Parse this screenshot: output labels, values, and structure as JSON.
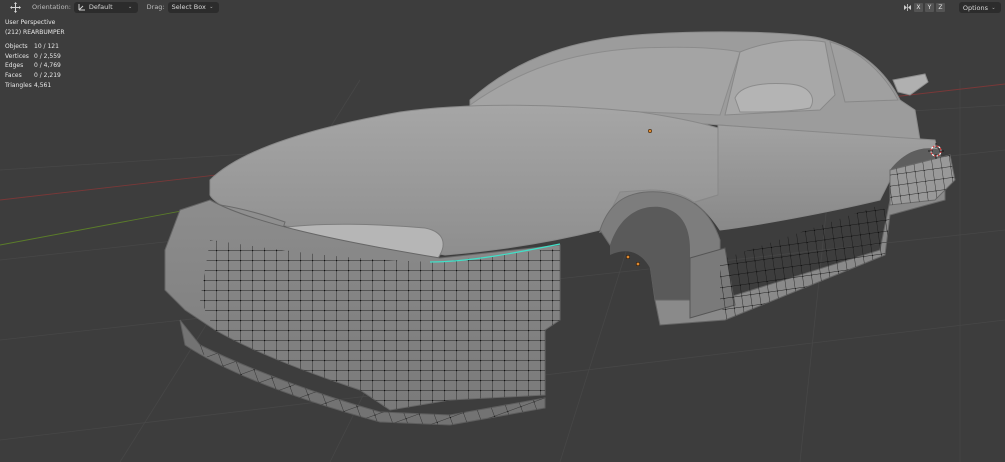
{
  "header": {
    "orientation_label": "Orientation:",
    "orientation_value": "Default",
    "drag_label": "Drag:",
    "drag_value": "Select Box",
    "axes": [
      "X",
      "Y",
      "Z"
    ],
    "options_label": "Options"
  },
  "overlay": {
    "view_name": "User Perspective",
    "object_name": "(212) REARBUMPER",
    "stats": [
      {
        "label": "Objects",
        "value": "10 / 121"
      },
      {
        "label": "Vertices",
        "value": "0 / 2,559"
      },
      {
        "label": "Edges",
        "value": "0 / 4,769"
      },
      {
        "label": "Faces",
        "value": "0 / 2,219"
      },
      {
        "label": "Triangles",
        "value": "4,561"
      }
    ]
  },
  "icons": {
    "transform": "move-gizmo-icon",
    "orientation": "transform-orientation-icon",
    "mirror": "mirror-butterfly-icon",
    "pivot": "3d-cursor-icon",
    "origin": "object-origin-icon"
  },
  "colors": {
    "viewport_bg": "#3d3d3d",
    "header_bg": "#303030",
    "mesh_gray": "#9a9a9a",
    "selected_edge": "#40e0c8",
    "origin_orange": "#e08a30",
    "vertex_black": "#000000",
    "grid_line": "#454545",
    "axis_red": "#8a3a3a",
    "axis_green": "#5b7d2a"
  }
}
